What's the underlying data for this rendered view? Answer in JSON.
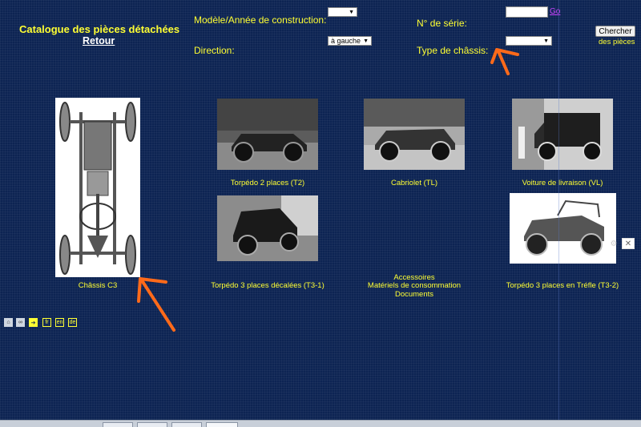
{
  "header": {
    "title": "Catalogue des pièces détachées",
    "back_label": "Retour"
  },
  "filters": {
    "model_label": "Modèle/Année de construction:",
    "model_value": "",
    "serial_label": "N° de série:",
    "serial_value": "",
    "go_label": "Go",
    "direction_label": "Direction:",
    "direction_value": "à gauche",
    "chassis_type_label": "Type de châssis:",
    "chassis_type_value": "",
    "search_label": "Chercher",
    "parts_label": "des pièces"
  },
  "catalog": {
    "chassis": "Châssis C3",
    "torpedo2": "Torpédo 2 places (T2)",
    "cabriolet": "Cabriolet (TL)",
    "delivery": "Voiture de livraison (VL)",
    "torpedo3": "Torpédo 3 places décalées (T3-1)",
    "accessories": "Accessoires",
    "consumables": "Matériels de consommation",
    "documents": "Documents",
    "trefle": "Torpédo 3 places en Tréfle (T3-2)"
  },
  "languages": [
    "fr",
    "en",
    "de"
  ],
  "colors": {
    "background": "#0d2453",
    "text": "#ffff33",
    "annotation_arrow": "#ff6a1a"
  },
  "icons": [
    "home-icon",
    "binoculars-icon",
    "login-arrow-icon",
    "gear-icon",
    "close-icon"
  ]
}
